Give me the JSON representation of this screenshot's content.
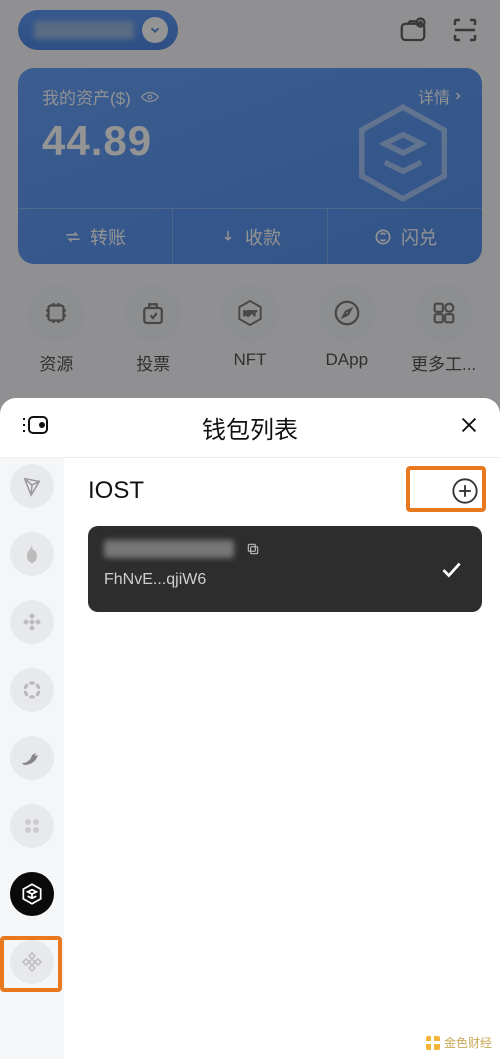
{
  "top": {
    "camera_icon": "camera-plus",
    "scan_icon": "scan"
  },
  "asset_card": {
    "title": "我的资产($)",
    "value": "44.89",
    "details_label": "详情",
    "actions": {
      "transfer": "转账",
      "receive": "收款",
      "swap": "闪兑"
    }
  },
  "grid": [
    {
      "label": "资源"
    },
    {
      "label": "投票"
    },
    {
      "label": "NFT"
    },
    {
      "label": "DApp"
    },
    {
      "label": "更多工..."
    }
  ],
  "sheet": {
    "title": "钱包列表",
    "chain_rail": [
      {
        "id": "tron"
      },
      {
        "id": "huobi"
      },
      {
        "id": "bnb"
      },
      {
        "id": "polkadot"
      },
      {
        "id": "bird"
      },
      {
        "id": "quad"
      },
      {
        "id": "iost",
        "active": true
      },
      {
        "id": "bnb2"
      }
    ],
    "list_title": "IOST",
    "wallet": {
      "address_short": "FhNvE...qjiW6"
    }
  },
  "watermark": "金色财经"
}
